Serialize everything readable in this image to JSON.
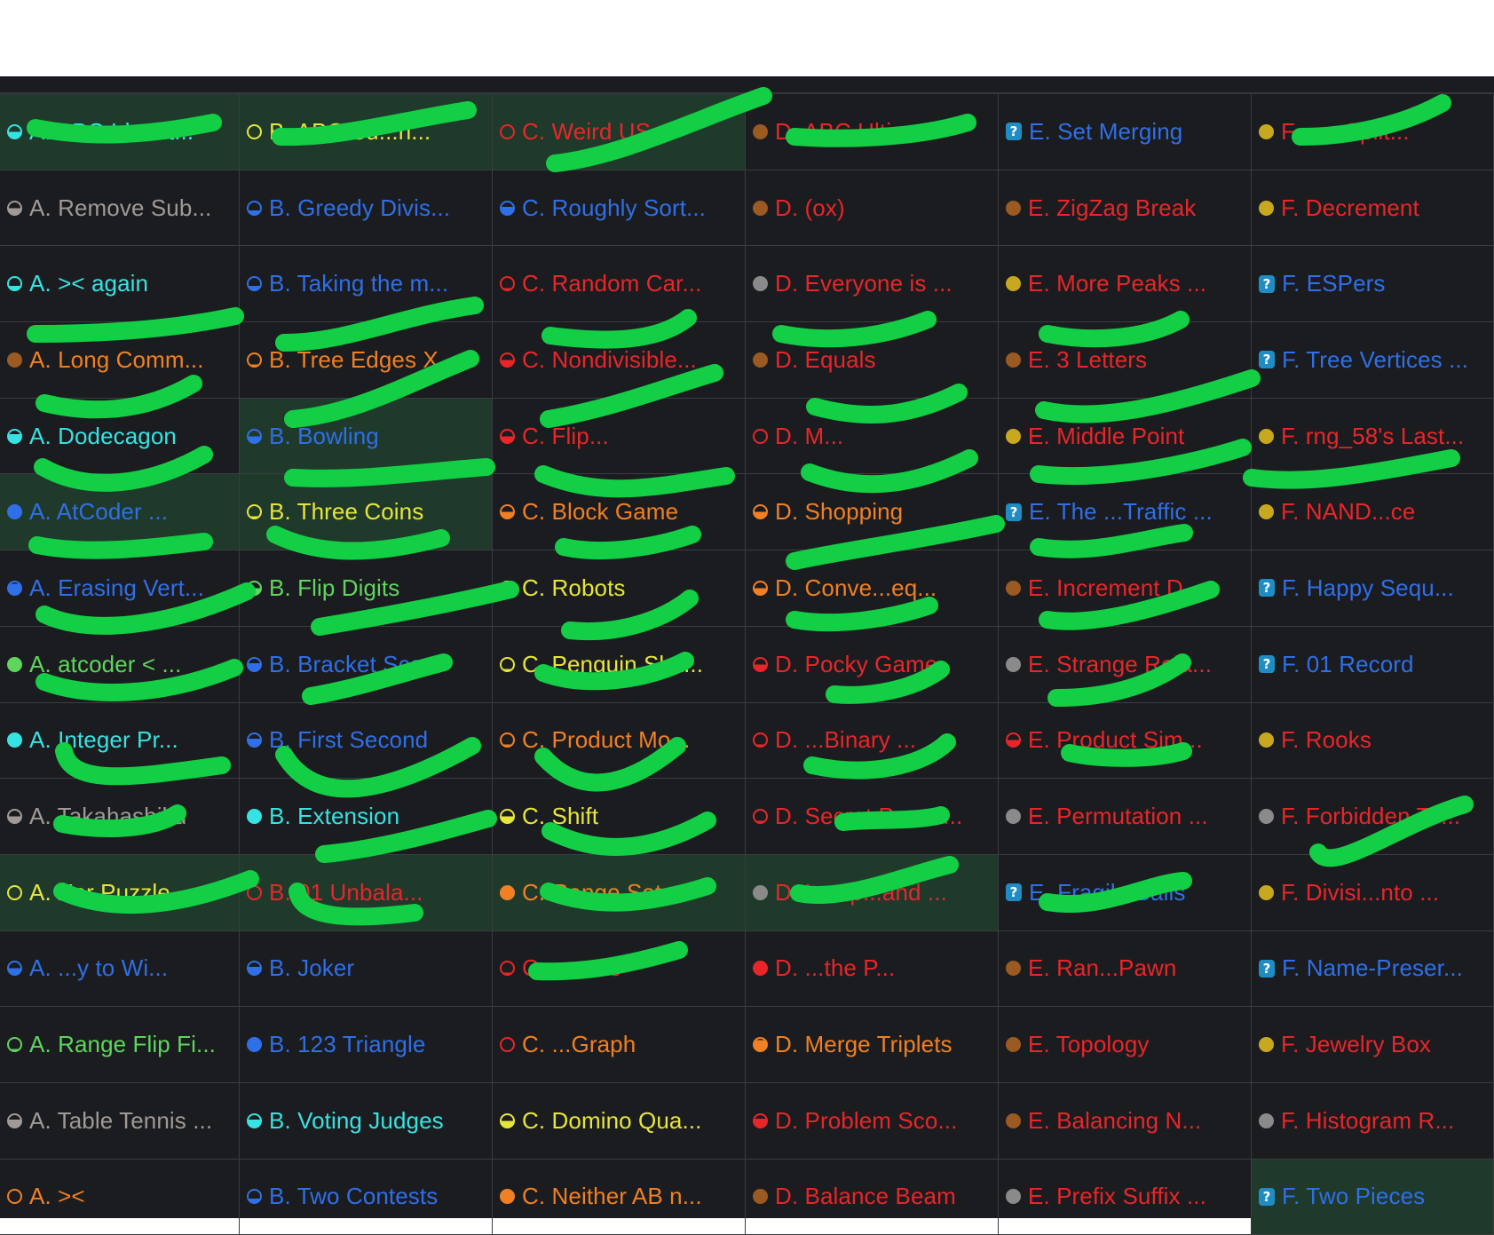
{
  "colors": {
    "gray": "#a09a96",
    "green": "#5ed65e",
    "cyan": "#36e3e3",
    "blue": "#2f6fe8",
    "yellow": "#e6e63a",
    "orange": "#f08023",
    "red": "#e8262a",
    "bronze": "#9a5a22",
    "silver": "#8a8a8a",
    "gold": "#c8a81e",
    "unknown": "#1f8cc4",
    "scribble": "#12cf46"
  },
  "grid": [
    [
      {
        "label": "A. ABC Identit...",
        "title_color": "cyan",
        "icon": "circle",
        "icon_color": "cyan",
        "fill": 0.5,
        "solved": true
      },
      {
        "label": "B. ABC Su...n...",
        "title_color": "yellow",
        "icon": "circle",
        "icon_color": "yellow",
        "fill": 0,
        "solved": true
      },
      {
        "label": "C. Weird US...",
        "title_color": "red",
        "icon": "circle",
        "icon_color": "red",
        "fill": 0,
        "solved": true
      },
      {
        "label": "D. ABC Ultim...",
        "title_color": "red",
        "icon": "circle",
        "icon_color": "bronze",
        "fill": 1,
        "solved": false
      },
      {
        "label": "E. Set Merging",
        "title_color": "blue",
        "icon": "unknown",
        "icon_color": "unknown",
        "fill": 0,
        "solved": false
      },
      {
        "label": "F. ...e Split...",
        "title_color": "red",
        "icon": "circle",
        "icon_color": "gold",
        "fill": 1,
        "solved": false
      }
    ],
    [
      {
        "label": "A. Remove Sub...",
        "title_color": "gray",
        "icon": "circle",
        "icon_color": "gray",
        "fill": 0.5,
        "solved": false
      },
      {
        "label": "B. Greedy Divis...",
        "title_color": "blue",
        "icon": "circle",
        "icon_color": "blue",
        "fill": 0.3,
        "solved": false
      },
      {
        "label": "C. Roughly Sort...",
        "title_color": "blue",
        "icon": "circle",
        "icon_color": "blue",
        "fill": 0.6,
        "solved": false
      },
      {
        "label": "D. (ox)",
        "title_color": "red",
        "icon": "circle",
        "icon_color": "bronze",
        "fill": 1,
        "solved": false
      },
      {
        "label": "E. ZigZag Break",
        "title_color": "red",
        "icon": "circle",
        "icon_color": "bronze",
        "fill": 1,
        "solved": false
      },
      {
        "label": "F. Decrement",
        "title_color": "red",
        "icon": "circle",
        "icon_color": "gold",
        "fill": 1,
        "solved": false
      }
    ],
    [
      {
        "label": "A. >< again",
        "title_color": "cyan",
        "icon": "circle",
        "icon_color": "cyan",
        "fill": 0.3,
        "solved": false
      },
      {
        "label": "B. Taking the m...",
        "title_color": "blue",
        "icon": "circle",
        "icon_color": "blue",
        "fill": 0.3,
        "solved": false
      },
      {
        "label": "C. Random Car...",
        "title_color": "red",
        "icon": "circle",
        "icon_color": "red",
        "fill": 0.1,
        "solved": false
      },
      {
        "label": "D. Everyone is ...",
        "title_color": "red",
        "icon": "circle",
        "icon_color": "silver",
        "fill": 1,
        "solved": false
      },
      {
        "label": "E. More Peaks ...",
        "title_color": "red",
        "icon": "circle",
        "icon_color": "gold",
        "fill": 1,
        "solved": false
      },
      {
        "label": "F. ESPers",
        "title_color": "blue",
        "icon": "unknown",
        "icon_color": "unknown",
        "fill": 0,
        "solved": false
      }
    ],
    [
      {
        "label": "A. Long Comm...",
        "title_color": "orange",
        "icon": "circle",
        "icon_color": "bronze",
        "fill": 1,
        "solved": false
      },
      {
        "label": "B. Tree Edges X...",
        "title_color": "orange",
        "icon": "circle",
        "icon_color": "orange",
        "fill": 0.1,
        "solved": false
      },
      {
        "label": "C. Nondivisible...",
        "title_color": "red",
        "icon": "circle",
        "icon_color": "red",
        "fill": 0.5,
        "solved": false
      },
      {
        "label": "D. Equals",
        "title_color": "red",
        "icon": "circle",
        "icon_color": "bronze",
        "fill": 1,
        "solved": false
      },
      {
        "label": "E. 3 Letters",
        "title_color": "red",
        "icon": "circle",
        "icon_color": "bronze",
        "fill": 1,
        "solved": false
      },
      {
        "label": "F. Tree Vertices ...",
        "title_color": "blue",
        "icon": "unknown",
        "icon_color": "unknown",
        "fill": 0,
        "solved": false
      }
    ],
    [
      {
        "label": "A. Dodecagon",
        "title_color": "cyan",
        "icon": "circle",
        "icon_color": "cyan",
        "fill": 0.7,
        "solved": false
      },
      {
        "label": "B. Bowling",
        "title_color": "blue",
        "icon": "circle",
        "icon_color": "blue",
        "fill": 0.5,
        "solved": true
      },
      {
        "label": "C. Flip...",
        "title_color": "red",
        "icon": "circle",
        "icon_color": "red",
        "fill": 0.5,
        "solved": false
      },
      {
        "label": "D. M...",
        "title_color": "red",
        "icon": "circle",
        "icon_color": "red",
        "fill": 0,
        "solved": false
      },
      {
        "label": "E. Middle Point",
        "title_color": "red",
        "icon": "circle",
        "icon_color": "gold",
        "fill": 1,
        "solved": false
      },
      {
        "label": "F. rng_58's Last...",
        "title_color": "red",
        "icon": "circle",
        "icon_color": "gold",
        "fill": 1,
        "solved": false
      }
    ],
    [
      {
        "label": "A. AtCoder ...",
        "title_color": "blue",
        "icon": "circle",
        "icon_color": "blue",
        "fill": 1,
        "solved": true
      },
      {
        "label": "B. Three Coins",
        "title_color": "yellow",
        "icon": "circle",
        "icon_color": "yellow",
        "fill": 0.1,
        "solved": true
      },
      {
        "label": "C. Block Game",
        "title_color": "orange",
        "icon": "circle",
        "icon_color": "orange",
        "fill": 0.5,
        "solved": false
      },
      {
        "label": "D. Shopping",
        "title_color": "orange",
        "icon": "circle",
        "icon_color": "orange",
        "fill": 0.5,
        "solved": false
      },
      {
        "label": "E. The ...Traffic ...",
        "title_color": "blue",
        "icon": "unknown",
        "icon_color": "unknown",
        "fill": 0,
        "solved": false
      },
      {
        "label": "F. NAND...ce",
        "title_color": "red",
        "icon": "circle",
        "icon_color": "gold",
        "fill": 1,
        "solved": false
      }
    ],
    [
      {
        "label": "A. Erasing Vert...",
        "title_color": "blue",
        "icon": "circle",
        "icon_color": "blue",
        "fill": 0.9,
        "solved": false
      },
      {
        "label": "B. Flip Digits",
        "title_color": "green",
        "icon": "circle",
        "icon_color": "green",
        "fill": 0.5,
        "solved": false
      },
      {
        "label": "C. Robots",
        "title_color": "yellow",
        "icon": "circle",
        "icon_color": "yellow",
        "fill": 0.5,
        "solved": false
      },
      {
        "label": "D. Conve...eq...",
        "title_color": "orange",
        "icon": "circle",
        "icon_color": "orange",
        "fill": 0.5,
        "solved": false
      },
      {
        "label": "E. Increment D...",
        "title_color": "red",
        "icon": "circle",
        "icon_color": "bronze",
        "fill": 1,
        "solved": false
      },
      {
        "label": "F. Happy Sequ...",
        "title_color": "blue",
        "icon": "unknown",
        "icon_color": "unknown",
        "fill": 0,
        "solved": false
      }
    ],
    [
      {
        "label": "A. atcoder < ...",
        "title_color": "green",
        "icon": "circle",
        "icon_color": "green",
        "fill": 1,
        "solved": false
      },
      {
        "label": "B. Bracket Score",
        "title_color": "blue",
        "icon": "circle",
        "icon_color": "blue",
        "fill": 0.6,
        "solved": false
      },
      {
        "label": "C. Penguin Ska...",
        "title_color": "yellow",
        "icon": "circle",
        "icon_color": "yellow",
        "fill": 0.1,
        "solved": false
      },
      {
        "label": "D. Pocky Game",
        "title_color": "red",
        "icon": "circle",
        "icon_color": "red",
        "fill": 0.5,
        "solved": false
      },
      {
        "label": "E. Strange Rela...",
        "title_color": "red",
        "icon": "circle",
        "icon_color": "silver",
        "fill": 1,
        "solved": false
      },
      {
        "label": "F. 01 Record",
        "title_color": "blue",
        "icon": "unknown",
        "icon_color": "unknown",
        "fill": 0,
        "solved": false
      }
    ],
    [
      {
        "label": "A. Integer Pr...",
        "title_color": "cyan",
        "icon": "circle",
        "icon_color": "cyan",
        "fill": 1,
        "solved": false
      },
      {
        "label": "B. First Second",
        "title_color": "blue",
        "icon": "circle",
        "icon_color": "blue",
        "fill": 0.6,
        "solved": false
      },
      {
        "label": "C. Product Mo...",
        "title_color": "orange",
        "icon": "circle",
        "icon_color": "orange",
        "fill": 0.1,
        "solved": false
      },
      {
        "label": "D. ...Binary ...",
        "title_color": "red",
        "icon": "circle",
        "icon_color": "red",
        "fill": 0.1,
        "solved": false
      },
      {
        "label": "E. Product Sim...",
        "title_color": "red",
        "icon": "circle",
        "icon_color": "red",
        "fill": 0.5,
        "solved": false
      },
      {
        "label": "F. Rooks",
        "title_color": "red",
        "icon": "circle",
        "icon_color": "gold",
        "fill": 1,
        "solved": false
      }
    ],
    [
      {
        "label": "A. Takahashiku",
        "title_color": "gray",
        "icon": "circle",
        "icon_color": "gray",
        "fill": 0.5,
        "solved": false
      },
      {
        "label": "B. Extension",
        "title_color": "cyan",
        "icon": "circle",
        "icon_color": "cyan",
        "fill": 1,
        "solved": false
      },
      {
        "label": "C. Shift",
        "title_color": "yellow",
        "icon": "circle",
        "icon_color": "yellow",
        "fill": 0.5,
        "solved": false
      },
      {
        "label": "D. Secret Passa...",
        "title_color": "red",
        "icon": "circle",
        "icon_color": "red",
        "fill": 0.1,
        "solved": false
      },
      {
        "label": "E. Permutation ...",
        "title_color": "red",
        "icon": "circle",
        "icon_color": "silver",
        "fill": 1,
        "solved": false
      },
      {
        "label": "F. Forbidden To...",
        "title_color": "red",
        "icon": "circle",
        "icon_color": "silver",
        "fill": 1,
        "solved": false
      }
    ],
    [
      {
        "label": "A. Xor Puzzle",
        "title_color": "yellow",
        "icon": "circle",
        "icon_color": "yellow",
        "fill": 0,
        "solved": true
      },
      {
        "label": "B. 01 Unbala...",
        "title_color": "red",
        "icon": "circle",
        "icon_color": "red",
        "fill": 0,
        "solved": true
      },
      {
        "label": "C. Range Set",
        "title_color": "orange",
        "icon": "circle",
        "icon_color": "orange",
        "fill": 1,
        "solved": true
      },
      {
        "label": "D. Lamp...and ...",
        "title_color": "red",
        "icon": "circle",
        "icon_color": "silver",
        "fill": 1,
        "solved": true
      },
      {
        "label": "E. Fragile Balls",
        "title_color": "blue",
        "icon": "unknown",
        "icon_color": "unknown",
        "fill": 0,
        "solved": false
      },
      {
        "label": "F. Divisi...nto ...",
        "title_color": "red",
        "icon": "circle",
        "icon_color": "gold",
        "fill": 1,
        "solved": false
      }
    ],
    [
      {
        "label": "A. ...y to Wi...",
        "title_color": "blue",
        "icon": "circle",
        "icon_color": "blue",
        "fill": 0.5,
        "solved": false
      },
      {
        "label": "B. Joker",
        "title_color": "blue",
        "icon": "circle",
        "icon_color": "blue",
        "fill": 0.6,
        "solved": false
      },
      {
        "label": "C. ...ence",
        "title_color": "red",
        "icon": "circle",
        "icon_color": "red",
        "fill": 0.1,
        "solved": false
      },
      {
        "label": "D. ...the P...",
        "title_color": "red",
        "icon": "circle",
        "icon_color": "red",
        "fill": 1,
        "solved": false
      },
      {
        "label": "E. Ran...Pawn",
        "title_color": "red",
        "icon": "circle",
        "icon_color": "bronze",
        "fill": 1,
        "solved": false
      },
      {
        "label": "F. Name-Preser...",
        "title_color": "blue",
        "icon": "unknown",
        "icon_color": "unknown",
        "fill": 0,
        "solved": false
      }
    ],
    [
      {
        "label": "A. Range Flip Fi...",
        "title_color": "green",
        "icon": "circle",
        "icon_color": "green",
        "fill": 0.1,
        "solved": false
      },
      {
        "label": "B. 123 Triangle",
        "title_color": "blue",
        "icon": "circle",
        "icon_color": "blue",
        "fill": 1,
        "solved": false
      },
      {
        "label": "C. ...Graph",
        "title_color": "orange",
        "icon": "circle",
        "icon_color": "red",
        "fill": 0,
        "solved": false
      },
      {
        "label": "D. Merge Triplets",
        "title_color": "orange",
        "icon": "circle",
        "icon_color": "orange",
        "fill": 0.9,
        "solved": false
      },
      {
        "label": "E. Topology",
        "title_color": "red",
        "icon": "circle",
        "icon_color": "bronze",
        "fill": 1,
        "solved": false
      },
      {
        "label": "F. Jewelry Box",
        "title_color": "red",
        "icon": "circle",
        "icon_color": "gold",
        "fill": 1,
        "solved": false
      }
    ],
    [
      {
        "label": "A. Table Tennis ...",
        "title_color": "gray",
        "icon": "circle",
        "icon_color": "gray",
        "fill": 0.6,
        "solved": false
      },
      {
        "label": "B. Voting Judges",
        "title_color": "cyan",
        "icon": "circle",
        "icon_color": "cyan",
        "fill": 0.6,
        "solved": false
      },
      {
        "label": "C. Domino Qua...",
        "title_color": "yellow",
        "icon": "circle",
        "icon_color": "yellow",
        "fill": 0.5,
        "solved": false
      },
      {
        "label": "D. Problem Sco...",
        "title_color": "red",
        "icon": "circle",
        "icon_color": "red",
        "fill": 0.7,
        "solved": false
      },
      {
        "label": "E. Balancing N...",
        "title_color": "red",
        "icon": "circle",
        "icon_color": "bronze",
        "fill": 1,
        "solved": false
      },
      {
        "label": "F. Histogram R...",
        "title_color": "red",
        "icon": "circle",
        "icon_color": "silver",
        "fill": 1,
        "solved": false
      }
    ],
    [
      {
        "label": "A. ><",
        "title_color": "orange",
        "icon": "circle",
        "icon_color": "orange",
        "fill": 0,
        "solved": false
      },
      {
        "label": "B. Two Contests",
        "title_color": "blue",
        "icon": "circle",
        "icon_color": "blue",
        "fill": 0.3,
        "solved": false
      },
      {
        "label": "C. Neither AB n...",
        "title_color": "orange",
        "icon": "circle",
        "icon_color": "orange",
        "fill": 1,
        "solved": false
      },
      {
        "label": "D. Balance Beam",
        "title_color": "red",
        "icon": "circle",
        "icon_color": "bronze",
        "fill": 1,
        "solved": false
      },
      {
        "label": "E. Prefix Suffix ...",
        "title_color": "red",
        "icon": "circle",
        "icon_color": "silver",
        "fill": 1,
        "solved": false
      },
      {
        "label": "F. Two Pieces",
        "title_color": "blue",
        "icon": "unknown",
        "icon_color": "unknown",
        "fill": 0,
        "solved": true
      }
    ]
  ]
}
